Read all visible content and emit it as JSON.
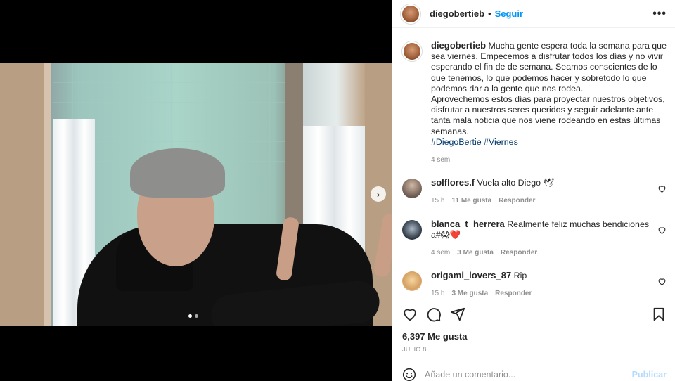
{
  "post": {
    "username": "diegobertieb",
    "separator": "•",
    "follow_label": "Seguir",
    "more_label": "•••"
  },
  "media": {
    "next_label": "›",
    "slide_count": 2,
    "active_slide": 1
  },
  "caption": {
    "username": "diegobertieb",
    "text": "Mucha gente espera toda la semana para que sea viernes. Empecemos a disfrutar todos los días y no vivir esperando el fin de de semana. Seamos conscientes de lo que tenemos, lo que podemos hacer y sobretodo lo que podemos dar a la gente que nos rodea.",
    "text2": "Aprovechemos estos días para proyectar nuestros objetivos, disfrutar a nuestros seres queridos y seguir adelante ante tanta mala noticia que nos viene rodeando en estas últimas semanas.",
    "hashtag1": "#DiegoBertie",
    "hashtag2": "#Viernes",
    "time": "4 sem"
  },
  "comments": [
    {
      "username": "solflores.f",
      "text": "Vuela alto Diego 🕊",
      "time": "15 h",
      "likes": "11 Me gusta",
      "reply": "Responder"
    },
    {
      "username": "blanca_t_herrera",
      "text": "Realmente feliz muchas bendiciones a#😱❤️",
      "time": "4 sem",
      "likes": "3 Me gusta",
      "reply": "Responder"
    },
    {
      "username": "origami_lovers_87",
      "text": "Rip",
      "time": "15 h",
      "likes": "3 Me gusta",
      "reply": "Responder"
    }
  ],
  "engagement": {
    "likes": "6,397 Me gusta",
    "date": "JULIO 8"
  },
  "add_comment": {
    "placeholder": "Añade un comentario...",
    "publish_label": "Publicar"
  },
  "colors": {
    "link": "#0095f6",
    "hashtag": "#00376b",
    "muted": "#8e8e8e",
    "publish_disabled": "#b3dbff"
  }
}
